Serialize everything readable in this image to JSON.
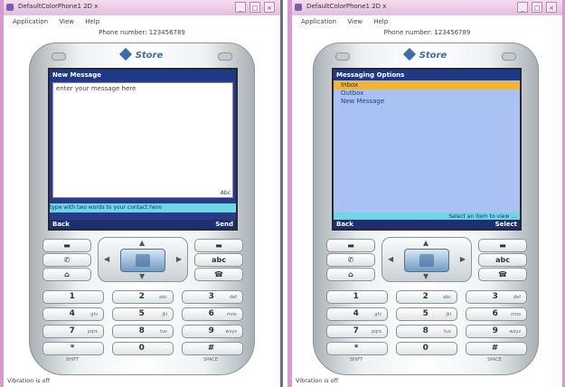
{
  "window_title": "DefaultColorPhone1 2D  x",
  "menu": [
    "Application",
    "View",
    "Help"
  ],
  "phone_number": "Phone number: 123456789",
  "status": "Vibration is off",
  "brand": "Store",
  "left_screen": {
    "title": "New Message",
    "body": "enter your message here",
    "mode": "Abc",
    "hint": "type with two words to your contact here",
    "soft_left": "Back",
    "soft_right": "Send"
  },
  "right_screen": {
    "title": "Messaging Options",
    "items": [
      "Inbox",
      "Outbox",
      "New Message"
    ],
    "hint": "Select an item to view ...",
    "soft_left": "Back",
    "soft_right": "Select"
  },
  "keys": [
    {
      "num": "1",
      "letters": ""
    },
    {
      "num": "2",
      "letters": "abc"
    },
    {
      "num": "3",
      "letters": "def"
    },
    {
      "num": "4",
      "letters": "ghi"
    },
    {
      "num": "5",
      "letters": "jkl"
    },
    {
      "num": "6",
      "letters": "mno"
    },
    {
      "num": "7",
      "letters": "pqrs"
    },
    {
      "num": "8",
      "letters": "tuv"
    },
    {
      "num": "9",
      "letters": "wxyz"
    },
    {
      "num": "*",
      "letters": ""
    },
    {
      "num": "0",
      "letters": ""
    },
    {
      "num": "#",
      "letters": ""
    }
  ],
  "side_labels": {
    "left": "SHIFT",
    "right": "SPACE"
  },
  "colors": {
    "screen_bg_left": "#ffffff",
    "screen_bg_right": "#a9c1f3",
    "highlight": "#f2b531",
    "frame_pink": "#d59bd1"
  }
}
